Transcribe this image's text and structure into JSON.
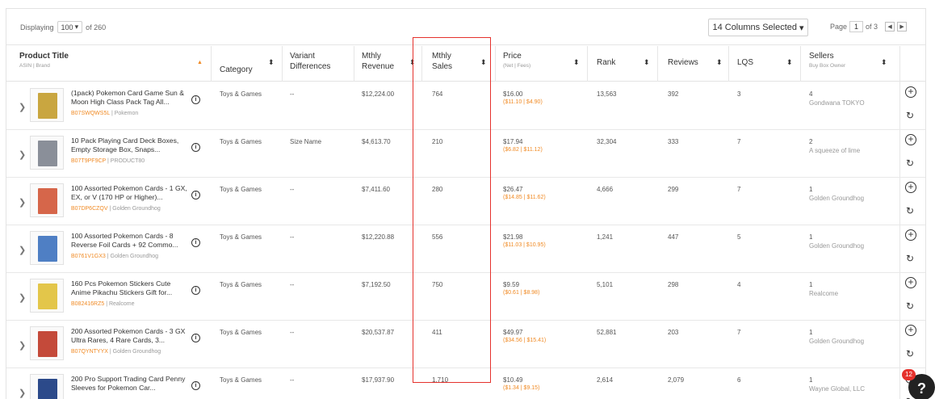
{
  "toolbar": {
    "displaying_label": "Displaying",
    "per_page": "100",
    "of_total": "of 260",
    "columns_selected": "14 Columns Selected",
    "page_label": "Page",
    "page_current": "1",
    "page_of": "of 3"
  },
  "columns": {
    "product_title": "Product Title",
    "product_title_sub": "ASIN | Brand",
    "category": "Category",
    "variant_1": "Variant",
    "variant_2": "Differences",
    "revenue_1": "Mthly",
    "revenue_2": "Revenue",
    "sales_1": "Mthly",
    "sales_2": "Sales",
    "price": "Price",
    "price_sub": "(Net | Fees)",
    "rank": "Rank",
    "reviews": "Reviews",
    "lqs": "LQS",
    "sellers": "Sellers",
    "sellers_sub": "Buy Box Owner"
  },
  "rows": [
    {
      "title": "(1pack) Pokemon Card Game Sun & Moon High Class Pack Tag All...",
      "asin": "B07SWQWS5L",
      "brand": "Pokemon",
      "category": "Toys & Games",
      "variant": "--",
      "revenue": "$12,224.00",
      "sales": "764",
      "price": "$16.00",
      "price_sub": "($11.10 | $4.90)",
      "rank": "13,563",
      "reviews": "392",
      "lqs": "3",
      "sellers": "4",
      "buybox": "Gondwana TOKYO",
      "thumb_color": "#c9a640"
    },
    {
      "title": "10 Pack Playing Card Deck Boxes, Empty Storage Box, Snaps...",
      "asin": "B07T9PF9CP",
      "brand": "PRODUCT80",
      "category": "Toys & Games",
      "variant": "Size Name",
      "revenue": "$4,613.70",
      "sales": "210",
      "price": "$17.94",
      "price_sub": "($6.82 | $11.12)",
      "rank": "32,304",
      "reviews": "333",
      "lqs": "7",
      "sellers": "2",
      "buybox": "A squeeze of lime",
      "thumb_color": "#8a8f99"
    },
    {
      "title": "100 Assorted Pokemon Cards - 1 GX, EX, or V (170 HP or Higher)...",
      "asin": "B07DP6CZQV",
      "brand": "Golden Groundhog",
      "category": "Toys & Games",
      "variant": "--",
      "revenue": "$7,411.60",
      "sales": "280",
      "price": "$26.47",
      "price_sub": "($14.85 | $11.62)",
      "rank": "4,666",
      "reviews": "299",
      "lqs": "7",
      "sellers": "1",
      "buybox": "Golden Groundhog",
      "thumb_color": "#d6664a"
    },
    {
      "title": "100 Assorted Pokemon Cards - 8 Reverse Foil Cards + 92 Commo...",
      "asin": "B0761V1GX3",
      "brand": "Golden Groundhog",
      "category": "Toys & Games",
      "variant": "--",
      "revenue": "$12,220.88",
      "sales": "556",
      "price": "$21.98",
      "price_sub": "($11.03 | $10.95)",
      "rank": "1,241",
      "reviews": "447",
      "lqs": "5",
      "sellers": "1",
      "buybox": "Golden Groundhog",
      "thumb_color": "#4f7fc4"
    },
    {
      "title": "160 Pcs Pokemon Stickers Cute Anime Pikachu Stickers Gift for...",
      "asin": "B082416RZ5",
      "brand": "Realcome",
      "category": "Toys & Games",
      "variant": "--",
      "revenue": "$7,192.50",
      "sales": "750",
      "price": "$9.59",
      "price_sub": "($0.61 | $8.98)",
      "rank": "5,101",
      "reviews": "298",
      "lqs": "4",
      "sellers": "1",
      "buybox": "Realcome",
      "thumb_color": "#e3c64a"
    },
    {
      "title": "200 Assorted Pokemon Cards - 3 GX Ultra Rares, 4 Rare Cards, 3...",
      "asin": "B07QYNTYYX",
      "brand": "Golden Groundhog",
      "category": "Toys & Games",
      "variant": "--",
      "revenue": "$20,537.87",
      "sales": "411",
      "price": "$49.97",
      "price_sub": "($34.56 | $15.41)",
      "rank": "52,881",
      "reviews": "203",
      "lqs": "7",
      "sellers": "1",
      "buybox": "Golden Groundhog",
      "thumb_color": "#c44a3a"
    },
    {
      "title": "200 Pro Support Trading Card Penny Sleeves for Pokemon Car...",
      "asin": "",
      "brand": "",
      "category": "Toys & Games",
      "variant": "--",
      "revenue": "$17,937.90",
      "sales": "1,710",
      "price": "$10.49",
      "price_sub": "($1.34 | $9.15)",
      "rank": "2,614",
      "reviews": "2,079",
      "lqs": "6",
      "sellers": "1",
      "buybox": "Wayne Global, LLC",
      "thumb_color": "#2c4a8a"
    }
  ],
  "chat_badge": "12",
  "icons": {
    "chevron": "chevron-right-icon",
    "info": "info-icon",
    "add": "add-circle-icon",
    "refresh": "refresh-icon"
  }
}
